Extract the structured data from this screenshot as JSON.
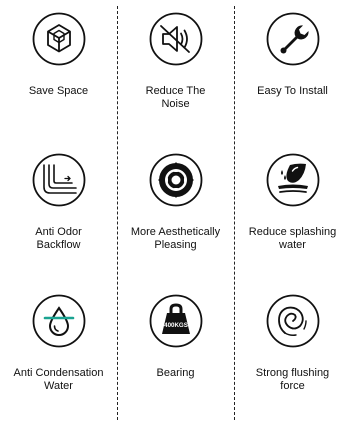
{
  "features": [
    {
      "label": "Save Space",
      "icon": "cube-icon"
    },
    {
      "label": "Reduce The\nNoise",
      "icon": "mute-speaker-icon"
    },
    {
      "label": "Easy To Install",
      "icon": "wrench-icon"
    },
    {
      "label": "Anti Odor\nBackflow",
      "icon": "pipe-flow-icon"
    },
    {
      "label": "More Aesthetically\nPleasing",
      "icon": "flower-pattern-icon"
    },
    {
      "label": "Reduce splashing\nwater",
      "icon": "water-splash-icon"
    },
    {
      "label": "Anti Condensation\nWater",
      "icon": "water-drop-icon"
    },
    {
      "label": "Bearing",
      "icon": "weight-icon",
      "badge": "400KGS"
    },
    {
      "label": "Strong flushing\nforce",
      "icon": "swirl-icon"
    }
  ]
}
